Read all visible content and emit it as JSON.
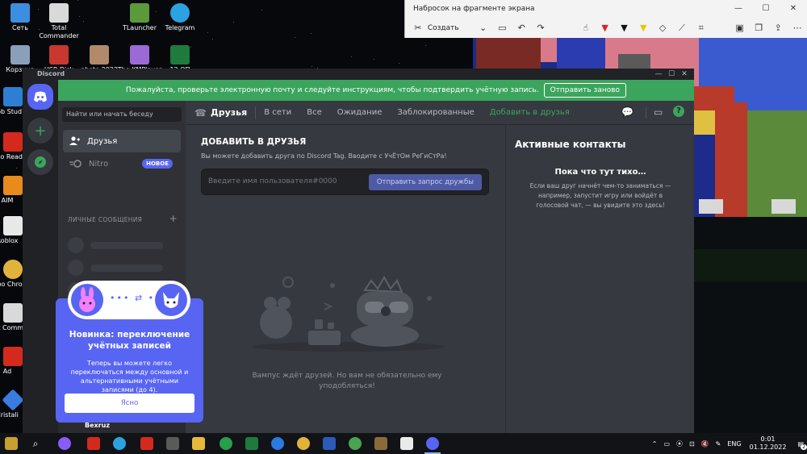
{
  "desktop": {
    "icons": [
      {
        "label": "Сеть",
        "color": "#3c8fe0"
      },
      {
        "label": "Total Commander",
        "color": "#d9d9d9"
      },
      {
        "label": "TLauncher",
        "color": "#5a9a3a"
      },
      {
        "label": "Telegram",
        "color": "#2aa3e0"
      },
      {
        "label": "Корзина",
        "color": "#8aa0b8"
      },
      {
        "label": "USB Disk",
        "color": "#c8382f"
      },
      {
        "label": "photo 2022",
        "color": "#b08a6a"
      },
      {
        "label": "The KMPlayer",
        "color": "#9b6ad6"
      },
      {
        "label": "12 ОП",
        "color": "#1f7a3e"
      }
    ],
    "left_icons": [
      "Rob Stud",
      "Ado Read",
      "AIM",
      "Roblox",
      "Goo Chro",
      "Tot Comm",
      "Ad",
      "Cristali"
    ]
  },
  "snip": {
    "title": "Набросок на фрагменте экрана",
    "create_label": "Создать",
    "window_controls": [
      "—",
      "☐",
      "✕"
    ]
  },
  "discord": {
    "app_name": "Discord",
    "window_controls": [
      "—",
      "☐",
      "✕"
    ],
    "notice": {
      "text": "Пожалуйста, проверьте электронную почту и следуйте инструкциям, чтобы подтвердить учётную запись.",
      "button": "Отправить заново"
    },
    "search_placeholder": "Найти или начать беседу",
    "sidebar": {
      "friends": "Друзья",
      "nitro": "Nitro",
      "nitro_badge": "НОВОЕ",
      "dm_title": "ЛИЧНЫЕ СООБЩЕНИЯ",
      "dm_add": "+"
    },
    "topbar": {
      "title": "Друзья",
      "tabs": [
        "В сети",
        "Все",
        "Ожидание",
        "Заблокированные"
      ],
      "add_friend": "Добавить в друзья"
    },
    "add_friend": {
      "heading": "ДОБАВИТЬ В ДРУЗЬЯ",
      "description": "Вы можете добавить друга по Discord Tag. Вводите с УчЁтОм РеГиСтРа!",
      "placeholder": "Введите имя пользователя#0000",
      "button": "Отправить запрос дружбы"
    },
    "empty_state": "Вампус ждёт друзей. Но вам не обязательно ему уподобляться!",
    "active_now": {
      "title": "Активные контакты",
      "quiet_title": "Пока что тут тихо…",
      "quiet_desc": "Если ваш друг начнёт чем-то заниматься — например, запустит игру или войдёт в голосовой чат, — вы увидите это здесь!"
    },
    "user": {
      "name": "Bexruz"
    }
  },
  "popup": {
    "title": "Новинка: переключение учётных записей",
    "description": "Теперь вы можете легко переключаться между основной и альтернативными учётными записями (до 4).",
    "button": "Ясно"
  },
  "taskbar": {
    "lang": "ENG",
    "time": "0:01",
    "date": "01.12.2022",
    "notif": "2"
  }
}
